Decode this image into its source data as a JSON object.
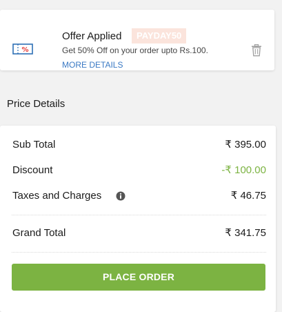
{
  "offer": {
    "title": "Offer Applied",
    "code": "PAYDAY50",
    "description": "Get 50% Off on your order upto Rs.100.",
    "more_details": "MORE DETAILS",
    "icon": "coupon-icon",
    "action_icon": "trash-icon"
  },
  "price_details": {
    "title": "Price Details",
    "rows": [
      {
        "label": "Sub Total",
        "value": "₹ 395.00"
      },
      {
        "label": "Discount",
        "value": "-₹ 100.00"
      },
      {
        "label": "Taxes and Charges",
        "value": "₹ 46.75"
      }
    ],
    "grand_total": {
      "label": "Grand Total",
      "value": "₹ 341.75"
    },
    "place_order": "PLACE ORDER"
  },
  "colors": {
    "accent_green": "#7cb342",
    "link_blue": "#3a79c4",
    "code_bg": "#fbe4dc"
  }
}
